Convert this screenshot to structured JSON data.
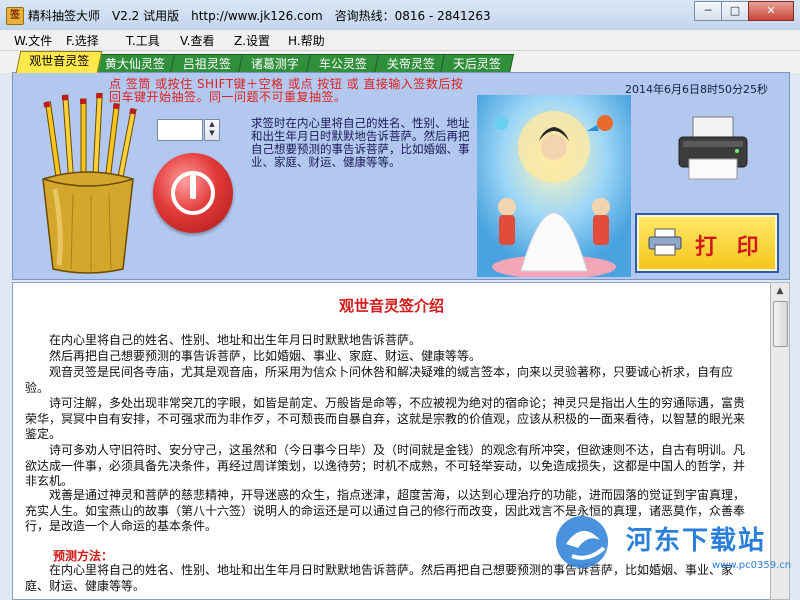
{
  "window": {
    "title": "精科抽签大师　V2.2 试用版　http://www.jk126.com　咨询热线：0816 - 2841263",
    "app_icon_char": "签",
    "buttons": [
      "─",
      "□",
      "✕"
    ]
  },
  "menu": [
    {
      "label": "W.文件"
    },
    {
      "label": "F.选择"
    },
    {
      "label": "T.工具"
    },
    {
      "label": "V.查看"
    },
    {
      "label": "Z.设置"
    },
    {
      "label": "H.帮助"
    }
  ],
  "tabs": [
    {
      "label": "观世音灵签",
      "active": true
    },
    {
      "label": "黄大仙灵签",
      "active": false
    },
    {
      "label": "吕祖灵签",
      "active": false
    },
    {
      "label": "诸葛测字",
      "active": false
    },
    {
      "label": "车公灵签",
      "active": false
    },
    {
      "label": "关帝灵签",
      "active": false
    },
    {
      "label": "天后灵签",
      "active": false
    }
  ],
  "top_panel": {
    "notice": "点 签筒 或按住 SHIFT键＋空格 或点 按钮 或 直接输入签数后按回车键开始抽签。同一问题不可重复抽签。",
    "datetime": "2014年6月6日8时50分25秒",
    "description": "求签时在内心里将自己的姓名、性别、地址和出生年月日时默默地告诉菩萨。然后再把自己想要预测的事告诉菩萨，比如婚姻、事业、家庭、财运、健康等等。",
    "number_value": "",
    "print_label": "打 印"
  },
  "content": {
    "title": "观世音灵签介绍",
    "paragraphs": [
      "在内心里将自己的姓名、性别、地址和出生年月日时默默地告诉菩萨。",
      "然后再把自己想要预测的事告诉菩萨，比如婚姻、事业、家庭、财运、健康等等。",
      "观音灵签是民间各寺庙，尤其是观音庙，所采用为信众卜问休咎和解决疑难的缄言签本，向来以灵验著称，只要诚心祈求，自有应验。",
      "诗可注解，多处出现非常突兀的字眼，如皆是前定、万般皆是命等，不应被视为绝对的宿命论；神灵只是指出人生的穷通际遇，富贵荣华，冥冥中自有安排，不可强求而为非作歹，不可颓丧而自暴自弃，这就是宗教的价值观，应该从积极的一面来看待，以智慧的眼光来鉴定。",
      "诗可多劝人守旧符时、安分守己，这虽然和（今日事今日毕）及（时间就是金钱）的观念有所冲突，但欲速则不达，自古有明训。凡欲达成一件事，必须具备先决条件，再经过周详策划，以逸待劳；时机不成熟，不可轻举妄动，以免造成损失，这都是中国人的哲学，并非玄机。",
      "戏善是通过神灵和菩萨的慈悲精神，开导迷惑的众生，指点迷津，超度苦海，以达到心理治疗的功能，进而园落的觉证到宇宙真理，充实人生。如宝燕山的故事（第八十六签）说明人的命运还是可以通过自己的修行而改变，因此戏言不是永恒的真理，诸恶莫作，众善奉行，是改造一个人命运的基本条件。"
    ],
    "method_title": "预测方法：",
    "method_text": "在内心里将自己的姓名、性别、地址和出生年月日时默默地告诉菩萨。然后再把自己想要预测的事告诉菩萨，比如婚姻、事业、家庭、财运、健康等等。"
  },
  "watermark": {
    "text": "河东下载站",
    "url": "www.pc0359.cn"
  },
  "colors": {
    "tab_active": "#ffe94a",
    "tab_inactive": "#2f8f3b",
    "panel_bg": "#b3c8ee",
    "title_red": "#d11a1a"
  }
}
